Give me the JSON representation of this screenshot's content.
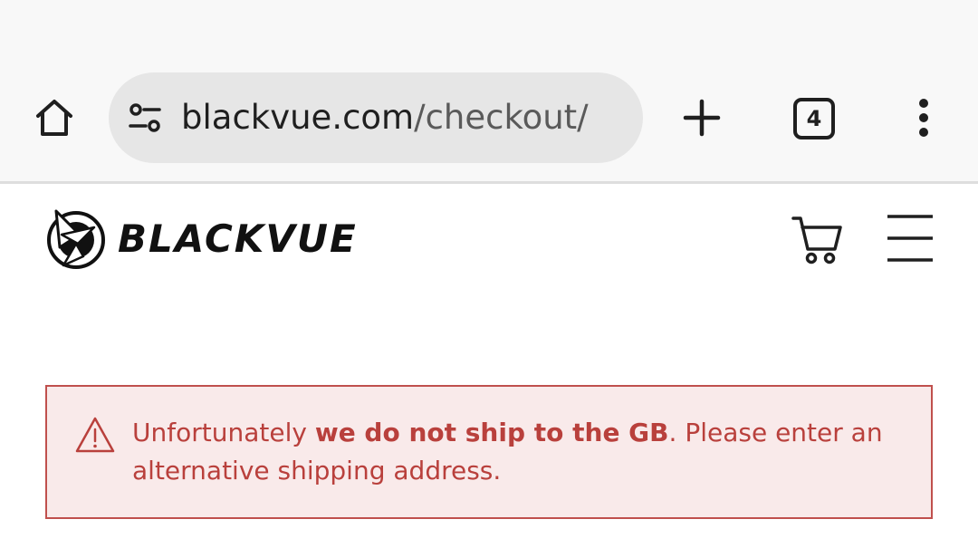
{
  "browser": {
    "url_domain": "blackvue.com",
    "url_path": "/checkout/",
    "tab_count": "4",
    "icons": {
      "home": "home-icon",
      "site_settings": "tune-icon",
      "new_tab": "plus-icon",
      "tabs": "tab-switcher-icon",
      "menu": "more-vert-icon"
    }
  },
  "site": {
    "logo_text": "BLACKVUE",
    "icons": {
      "cart": "cart-icon",
      "menu": "hamburger-icon"
    }
  },
  "alert": {
    "text_before": "Unfortunately ",
    "text_bold": "we do not ship to the GB",
    "text_after": ". Please enter an alternative shipping address.",
    "icon": "warning-icon",
    "colors": {
      "border": "#c0504d",
      "background": "#f9eaea",
      "text": "#b9403c"
    }
  }
}
